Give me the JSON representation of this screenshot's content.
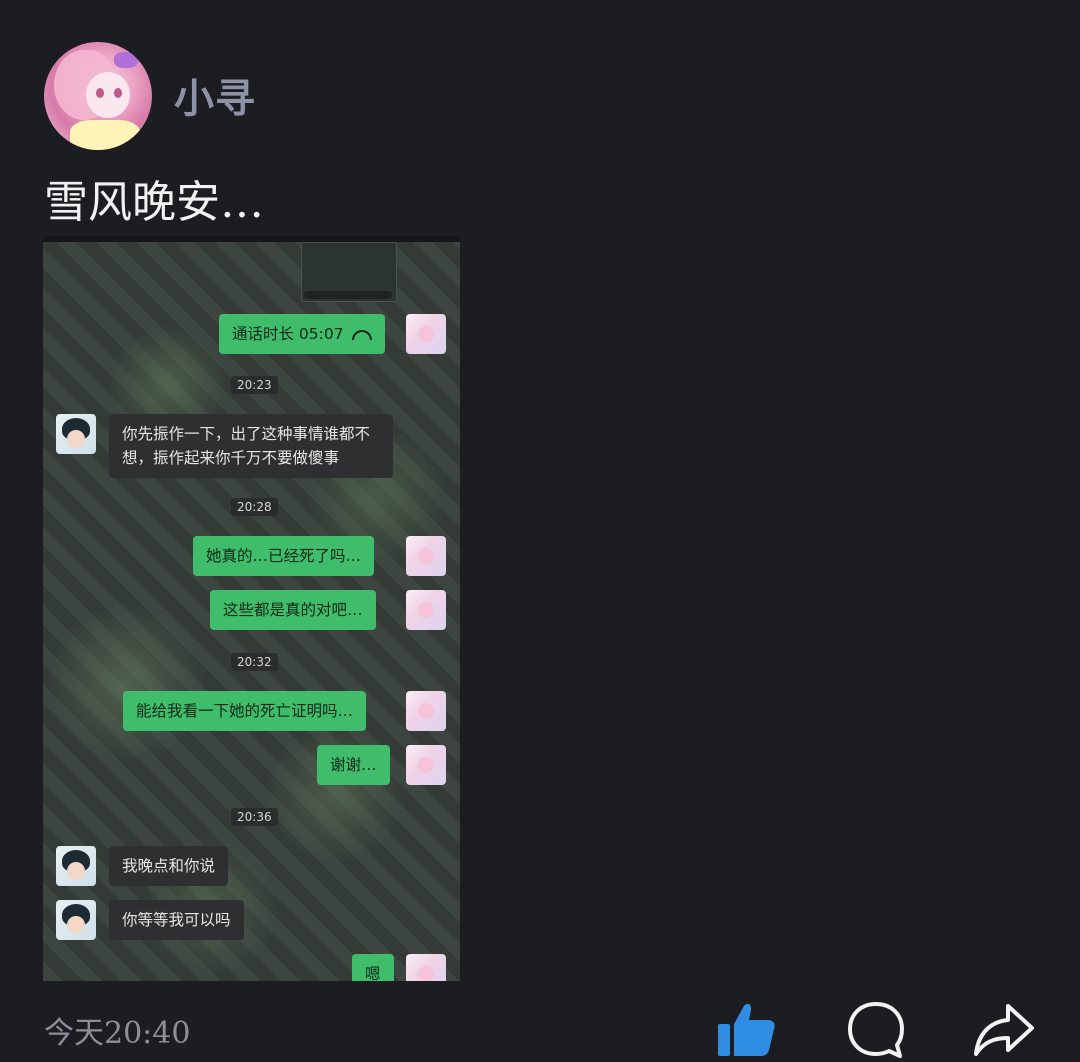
{
  "post": {
    "username": "小寻",
    "text": "雪风晚安…",
    "time": "今天20:40"
  },
  "screenshot": {
    "messages": [
      {
        "side": "me",
        "text": "通话时长 05:07",
        "icon": "phone-hangup-icon"
      },
      {
        "side": "time",
        "text": "20:23"
      },
      {
        "side": "other",
        "text": "你先振作一下，出了这种事情谁都不想，振作起来你千万不要做傻事"
      },
      {
        "side": "time",
        "text": "20:28"
      },
      {
        "side": "me",
        "text": "她真的…已经死了吗…"
      },
      {
        "side": "me",
        "text": "这些都是真的对吧…"
      },
      {
        "side": "time",
        "text": "20:32"
      },
      {
        "side": "me",
        "text": "能给我看一下她的死亡证明吗…"
      },
      {
        "side": "me",
        "text": "谢谢…"
      },
      {
        "side": "time",
        "text": "20:36"
      },
      {
        "side": "other",
        "text": "我晚点和你说"
      },
      {
        "side": "other",
        "text": "你等等我可以吗"
      },
      {
        "side": "me",
        "text": "嗯"
      }
    ]
  },
  "actions": {
    "like_icon": "thumbs-up-icon",
    "comment_icon": "comment-bubble-icon",
    "share_icon": "share-arrow-icon",
    "like_color": "#2f8de4"
  }
}
